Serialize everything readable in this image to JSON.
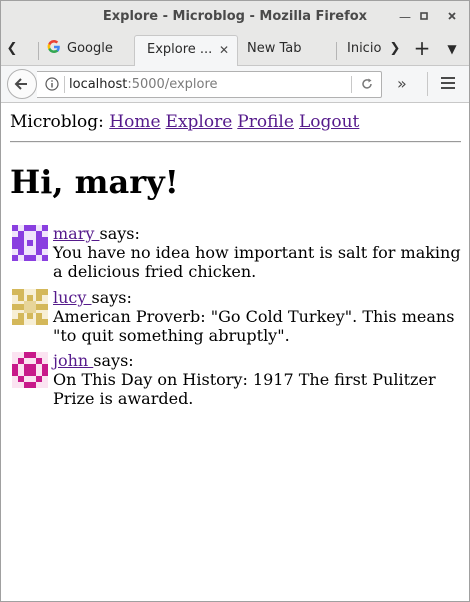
{
  "window": {
    "title": "Explore - Microblog - Mozilla Firefox"
  },
  "tabs": [
    {
      "label": "Google"
    },
    {
      "label": "Explore ..."
    },
    {
      "label": "New Tab"
    },
    {
      "label": "Inicio"
    }
  ],
  "address": {
    "host": "localhost",
    "path": ":5000/explore"
  },
  "page": {
    "brand": "Microblog:",
    "nav": [
      "Home",
      "Explore",
      "Profile",
      "Logout"
    ],
    "greeting": "Hi, mary!",
    "says": "says:",
    "posts": [
      {
        "user": "mary ",
        "body": "You have no idea how important is salt for making a delicious fried chicken.",
        "avatar_color": "#8a3fe0"
      },
      {
        "user": "lucy ",
        "body": "American Proverb: \"Go Cold Turkey\". This means \"to quit something abruptly\".",
        "avatar_color": "#d4b85a"
      },
      {
        "user": "john ",
        "body": "On This Day on History: 1917 The first Pulitzer Prize is awarded.",
        "avatar_color": "#c8198a"
      }
    ]
  }
}
